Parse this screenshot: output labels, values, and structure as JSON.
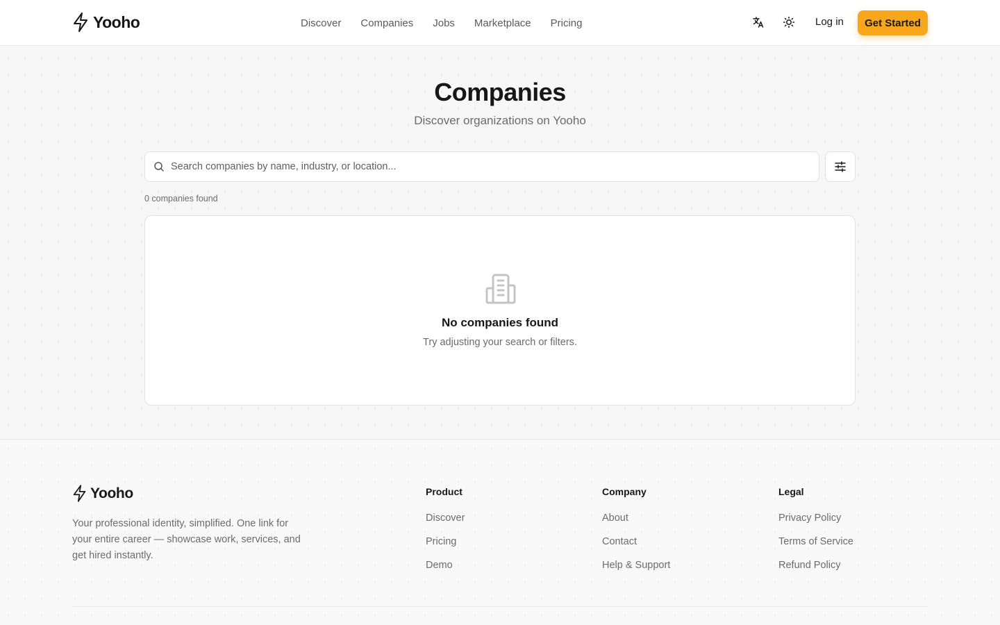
{
  "header": {
    "logo_text": "Yooho",
    "nav": [
      "Discover",
      "Companies",
      "Jobs",
      "Marketplace",
      "Pricing"
    ],
    "login_label": "Log in",
    "cta_label": "Get Started",
    "icons": [
      "translate-icon",
      "sun-icon"
    ]
  },
  "hero": {
    "title": "Companies",
    "subtitle": "Discover organizations on Yooho"
  },
  "search": {
    "placeholder": "Search companies by name, industry, or location...",
    "value": ""
  },
  "results": {
    "count_text": "0 companies found"
  },
  "empty_state": {
    "title": "No companies found",
    "text": "Try adjusting your search or filters."
  },
  "footer": {
    "logo_text": "Yooho",
    "tagline": "Your professional identity, simplified. One link for your entire career — showcase work, services, and get hired instantly.",
    "columns": [
      {
        "title": "Product",
        "links": [
          "Discover",
          "Pricing",
          "Demo"
        ]
      },
      {
        "title": "Company",
        "links": [
          "About",
          "Contact",
          "Help & Support"
        ]
      },
      {
        "title": "Legal",
        "links": [
          "Privacy Policy",
          "Terms of Service",
          "Refund Policy"
        ]
      }
    ]
  },
  "colors": {
    "accent": "#f8a61c",
    "text": "#171717",
    "muted": "#6b6b6b",
    "border": "#e2e2e2"
  }
}
